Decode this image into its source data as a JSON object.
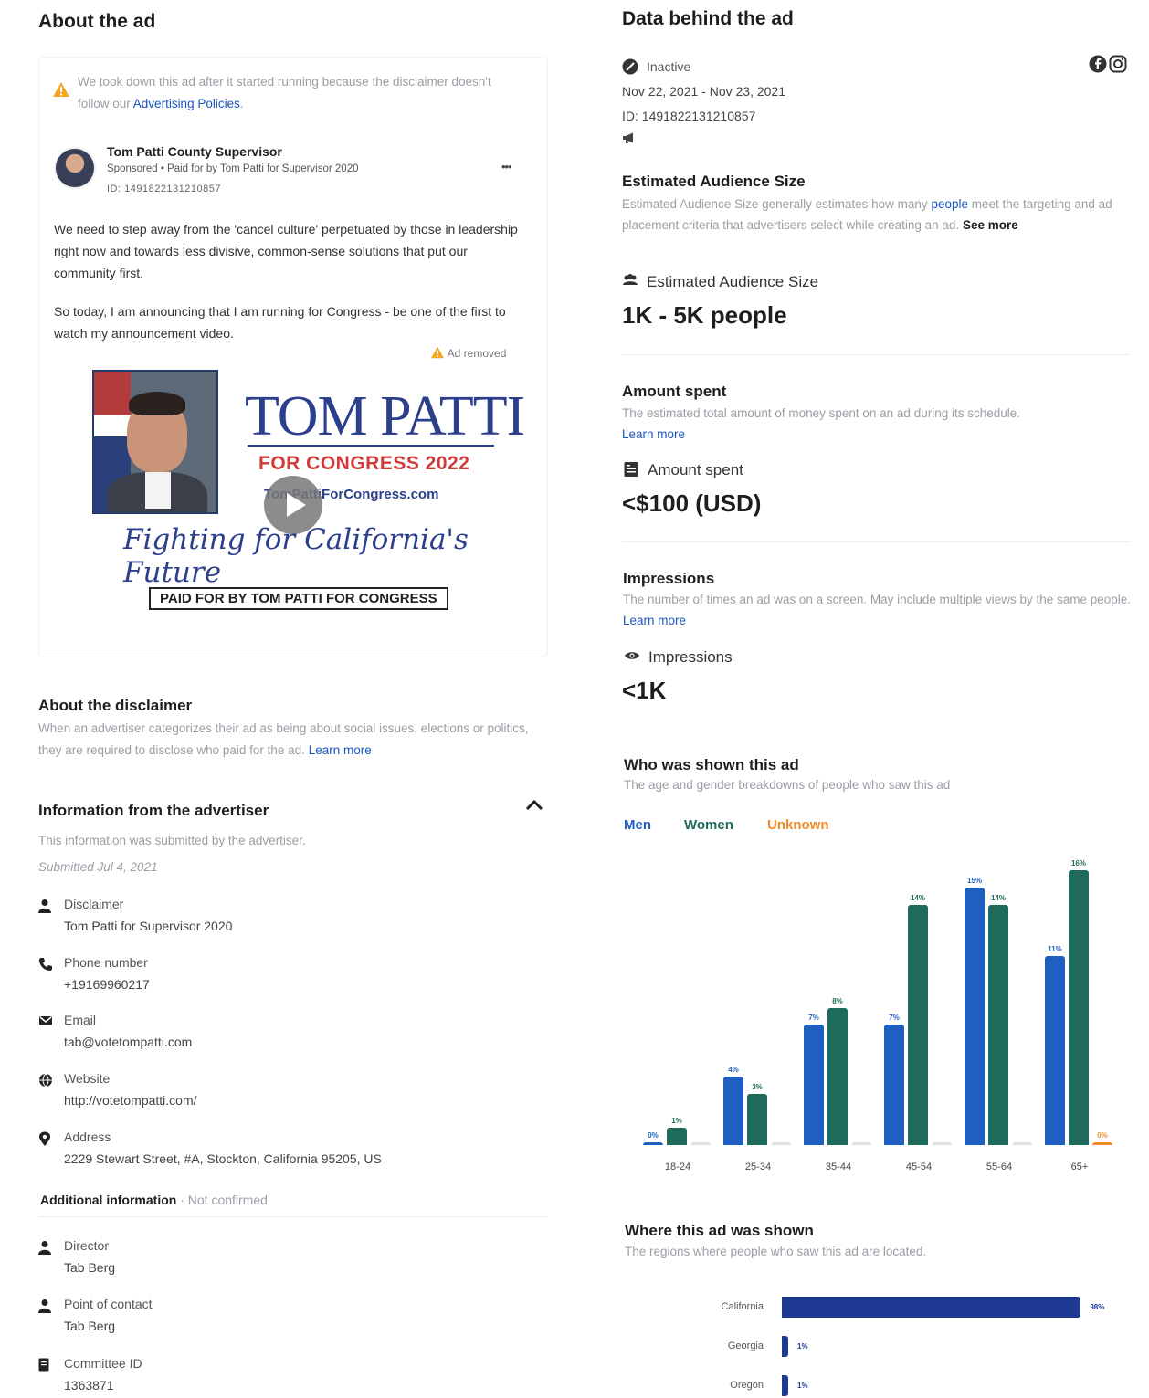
{
  "about_ad": {
    "title": "About the ad",
    "warning_text": "We took down this ad after it started running because the disclaimer doesn't follow our",
    "warning_link": "Advertising Policies",
    "page_name": "Tom Patti County Supervisor",
    "sponsored_line": "Sponsored • Paid for by Tom Patti for Supervisor 2020",
    "ad_id_line": "ID: 1491822131210857",
    "more_label": "•••",
    "body_p1": "We need to step away from the 'cancel culture' perpetuated by those in leadership right now and towards less divisive, common-sense solutions that put our community first.",
    "body_p2": "So today, I am announcing that I am running for Congress - be one of the first to watch my announcement video.",
    "ad_removed": "Ad removed",
    "creative": {
      "name_line1": "TOM",
      "name_line2": "PATTI",
      "subtitle": "FOR CONGRESS 2022",
      "website": "TomPattiForCongress.com",
      "slogan": "Fighting for California's Future",
      "paid_for": "PAID FOR BY TOM PATTI FOR CONGRESS"
    }
  },
  "disclaimer": {
    "title": "About the disclaimer",
    "text": "When an advertiser categorizes their ad as being about social issues, elections or politics, they are required to disclose who paid for the ad.",
    "link": "Learn more"
  },
  "advertiser_info": {
    "title": "Information from the advertiser",
    "subtitle": "This information was submitted by the advertiser.",
    "submitted": "Submitted Jul 4, 2021",
    "rows": [
      {
        "label": "Disclaimer",
        "value": "Tom Patti for Supervisor 2020",
        "icon": "person-icon"
      },
      {
        "label": "Phone number",
        "value": "+19169960217",
        "icon": "phone-icon"
      },
      {
        "label": "Email",
        "value": "tab@votetompatti.com",
        "icon": "envelope-icon"
      },
      {
        "label": "Website",
        "value": "http://votetompatti.com/",
        "icon": "globe-icon"
      },
      {
        "label": "Address",
        "value": "2229 Stewart Street, #A, Stockton, California 95205, US",
        "icon": "location-pin-icon"
      }
    ],
    "additional_title": "Additional information",
    "additional_status": " · Not confirmed",
    "additional_rows": [
      {
        "label": "Director",
        "value": "Tab Berg",
        "icon": "person-icon"
      },
      {
        "label": "Point of contact",
        "value": "Tab Berg",
        "icon": "person-icon"
      },
      {
        "label": "Committee ID",
        "value": "1363871",
        "icon": "document-icon"
      }
    ]
  },
  "data_behind": {
    "title": "Data behind the ad",
    "status": "Inactive",
    "dates": "Nov 22, 2021 - Nov 23, 2021",
    "id": "ID: 1491822131210857",
    "audience": {
      "title": "Estimated Audience Size",
      "desc_pre": "Estimated Audience Size generally estimates how many",
      "desc_link": "people",
      "desc_post": "meet the targeting and ad placement criteria that advertisers select while creating an ad.",
      "see_more": "See more",
      "label": "Estimated Audience Size",
      "value": "1K - 5K people"
    },
    "spent": {
      "title": "Amount spent",
      "desc": "The estimated total amount of money spent on an ad during its schedule.",
      "link": "Learn more",
      "label": "Amount spent",
      "value": "<$100 (USD)"
    },
    "impressions": {
      "title": "Impressions",
      "desc": "The number of times an ad was on a screen. May include multiple views by the same people.",
      "link": "Learn more",
      "label": "Impressions",
      "value": "<1K"
    },
    "who": {
      "title": "Who was shown this ad",
      "desc": "The age and gender breakdowns of people who saw this ad",
      "tab_men": "Men",
      "tab_women": "Women",
      "tab_unknown": "Unknown"
    },
    "where": {
      "title": "Where this ad was shown",
      "desc": "The regions where people who saw this ad are located."
    }
  },
  "colors": {
    "men": "#1f5fbf",
    "women": "#1e6b5c",
    "unknown": "#f08b2c",
    "region_bar": "#1f3a93",
    "link": "#1a55c0"
  },
  "chart_data": [
    {
      "type": "bar",
      "categories": [
        "18-24",
        "25-34",
        "35-44",
        "45-54",
        "55-64",
        "65+"
      ],
      "series": [
        {
          "name": "Men",
          "values": [
            0,
            4,
            7,
            7,
            15,
            11
          ],
          "labels": [
            "0%",
            "4%",
            "7%",
            "7%",
            "15%",
            "11%"
          ]
        },
        {
          "name": "Women",
          "values": [
            1,
            3,
            8,
            14,
            14,
            16
          ],
          "labels": [
            "1%",
            "3%",
            "8%",
            "14%",
            "14%",
            "16%"
          ]
        },
        {
          "name": "Unknown",
          "values": [
            0,
            0,
            0,
            0,
            0,
            0
          ],
          "labels": [
            "",
            "",
            "",
            "",
            "",
            "0%"
          ]
        }
      ],
      "ylim": [
        0,
        16
      ]
    },
    {
      "type": "bar",
      "orientation": "horizontal",
      "categories": [
        "California",
        "Georgia",
        "Oregon"
      ],
      "values": [
        98,
        1,
        1
      ],
      "labels": [
        "98%",
        "1%",
        "1%"
      ]
    }
  ]
}
